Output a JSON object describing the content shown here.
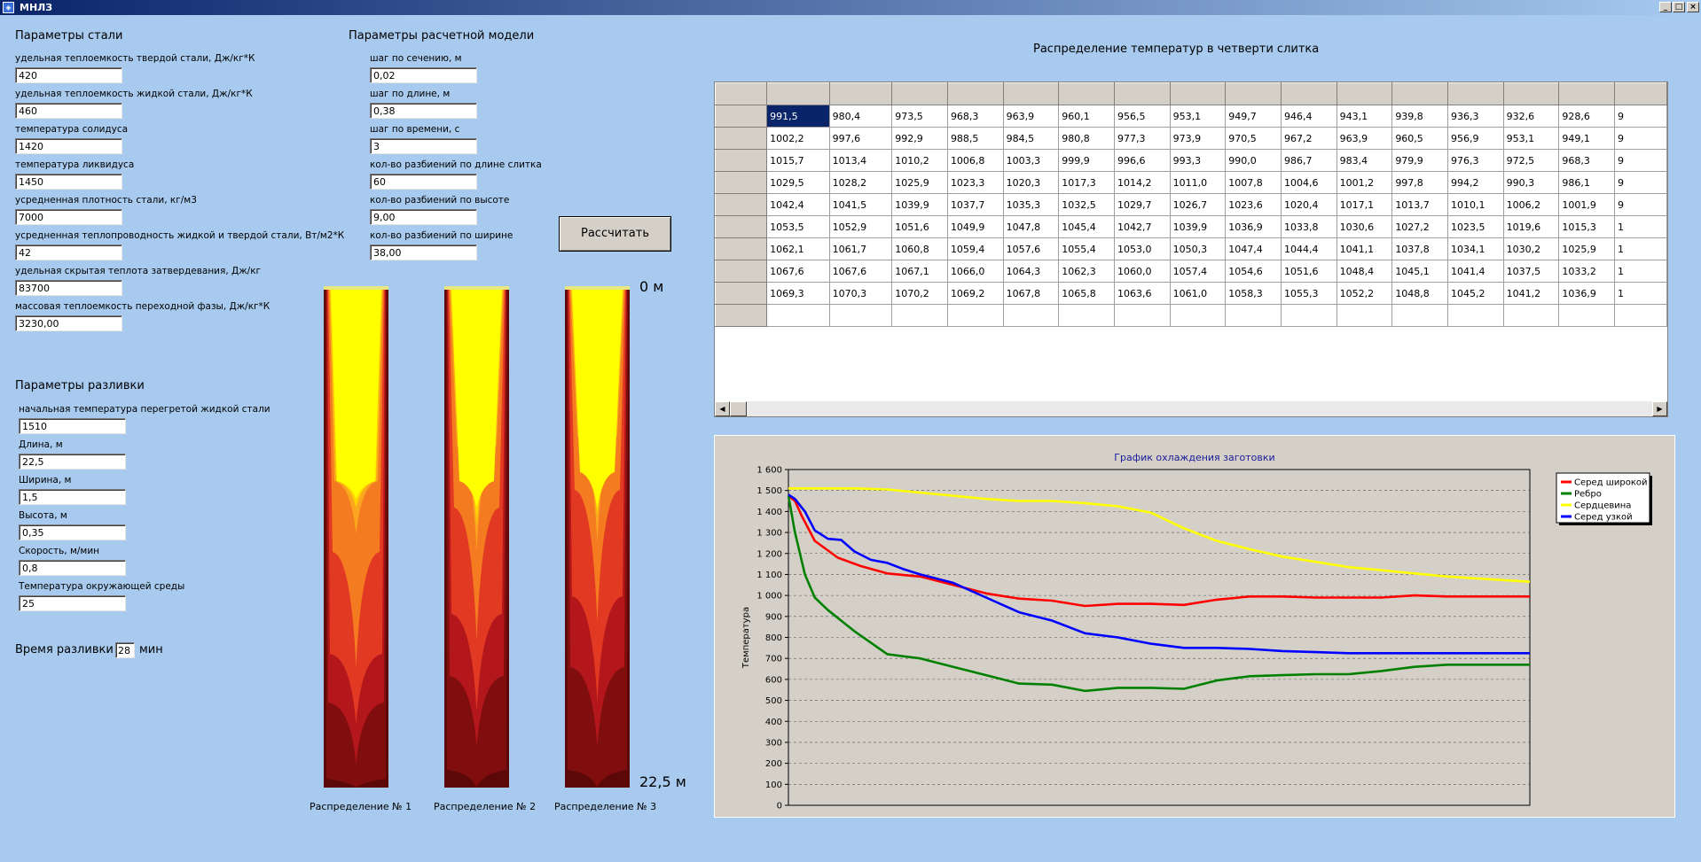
{
  "window": {
    "title": "МНЛЗ",
    "min_glyph": "_",
    "max_glyph": "□",
    "close_glyph": "×"
  },
  "steel": {
    "title": "Параметры стали",
    "fields": [
      {
        "label": "удельная теплоемкость твердой стали, Дж/кг*К",
        "value": "420"
      },
      {
        "label": "удельная теплоемкость жидкой стали, Дж/кг*К",
        "value": "460"
      },
      {
        "label": "температура солидуса",
        "value": "1420"
      },
      {
        "label": "температура ликвидуса",
        "value": "1450"
      },
      {
        "label": "усредненная плотность стали, кг/м3",
        "value": "7000"
      },
      {
        "label": "усредненная теплопроводность жидкой и твердой стали, Вт/м2*К",
        "value": "42"
      },
      {
        "label": "удельная скрытая теплота затвердевания, Дж/кг",
        "value": "83700"
      },
      {
        "label": "массовая теплоемкость переходной фазы, Дж/кг*К",
        "value": "3230,00"
      }
    ]
  },
  "model": {
    "title": "Параметры расчетной модели",
    "fields": [
      {
        "label": "шаг по сечению, м",
        "value": "0,02"
      },
      {
        "label": "шаг по длине, м",
        "value": "0,38"
      },
      {
        "label": "шаг по времени, с",
        "value": "3"
      },
      {
        "label": "кол-во разбиений по длине слитка",
        "value": "60"
      },
      {
        "label": "кол-во разбиений по высоте",
        "value": "9,00"
      },
      {
        "label": "кол-во разбиений по ширине",
        "value": "38,00"
      }
    ]
  },
  "casting": {
    "title": "Параметры разливки",
    "fields": [
      {
        "label": "начальная температура перегретой жидкой стали",
        "value": "1510"
      },
      {
        "label": "Длина, м",
        "value": "22,5"
      },
      {
        "label": "Ширина, м",
        "value": "1,5"
      },
      {
        "label": "Высота, м",
        "value": "0,35"
      },
      {
        "label": "Скорость, м/мин",
        "value": "0,8"
      },
      {
        "label": "Температура  окружающей среды",
        "value": "25"
      }
    ],
    "time_label": "Время разливки",
    "time_value": "28",
    "time_unit": "мин"
  },
  "calc_button": "Рассчитать",
  "distribution": {
    "top_mark": "0 м",
    "bottom_mark": "22,5 м",
    "labels": [
      "Распределение № 1",
      "Распределение № 2",
      "Распределение № 3"
    ],
    "colors": [
      "#ffff00",
      "#ffd500",
      "#faa61e",
      "#f47b20",
      "#e23a22",
      "#b3161b",
      "#800e0e",
      "#5c0808"
    ]
  },
  "table": {
    "title": "Распределение температур в четверти слитка",
    "rows": [
      [
        "991,5",
        "980,4",
        "973,5",
        "968,3",
        "963,9",
        "960,1",
        "956,5",
        "953,1",
        "949,7",
        "946,4",
        "943,1",
        "939,8",
        "936,3",
        "932,6",
        "928,6",
        "9"
      ],
      [
        "1002,2",
        "997,6",
        "992,9",
        "988,5",
        "984,5",
        "980,8",
        "977,3",
        "973,9",
        "970,5",
        "967,2",
        "963,9",
        "960,5",
        "956,9",
        "953,1",
        "949,1",
        "9"
      ],
      [
        "1015,7",
        "1013,4",
        "1010,2",
        "1006,8",
        "1003,3",
        "999,9",
        "996,6",
        "993,3",
        "990,0",
        "986,7",
        "983,4",
        "979,9",
        "976,3",
        "972,5",
        "968,3",
        "9"
      ],
      [
        "1029,5",
        "1028,2",
        "1025,9",
        "1023,3",
        "1020,3",
        "1017,3",
        "1014,2",
        "1011,0",
        "1007,8",
        "1004,6",
        "1001,2",
        "997,8",
        "994,2",
        "990,3",
        "986,1",
        "9"
      ],
      [
        "1042,4",
        "1041,5",
        "1039,9",
        "1037,7",
        "1035,3",
        "1032,5",
        "1029,7",
        "1026,7",
        "1023,6",
        "1020,4",
        "1017,1",
        "1013,7",
        "1010,1",
        "1006,2",
        "1001,9",
        "9"
      ],
      [
        "1053,5",
        "1052,9",
        "1051,6",
        "1049,9",
        "1047,8",
        "1045,4",
        "1042,7",
        "1039,9",
        "1036,9",
        "1033,8",
        "1030,6",
        "1027,2",
        "1023,5",
        "1019,6",
        "1015,3",
        "1"
      ],
      [
        "1062,1",
        "1061,7",
        "1060,8",
        "1059,4",
        "1057,6",
        "1055,4",
        "1053,0",
        "1050,3",
        "1047,4",
        "1044,4",
        "1041,1",
        "1037,8",
        "1034,1",
        "1030,2",
        "1025,9",
        "1"
      ],
      [
        "1067,6",
        "1067,6",
        "1067,1",
        "1066,0",
        "1064,3",
        "1062,3",
        "1060,0",
        "1057,4",
        "1054,6",
        "1051,6",
        "1048,4",
        "1045,1",
        "1041,4",
        "1037,5",
        "1033,2",
        "1"
      ],
      [
        "1069,3",
        "1070,3",
        "1070,2",
        "1069,2",
        "1067,8",
        "1065,8",
        "1063,6",
        "1061,0",
        "1058,3",
        "1055,3",
        "1052,2",
        "1048,8",
        "1045,2",
        "1041,2",
        "1036,9",
        "1"
      ]
    ],
    "scroll_left_glyph": "◀",
    "scroll_right_glyph": "▶"
  },
  "chart_data": {
    "type": "line",
    "title": "График охлаждения заготовки",
    "xlabel": "",
    "ylabel": "Температура",
    "ylim": [
      0,
      1600
    ],
    "xlim": [
      0,
      22.5
    ],
    "yticks": [
      "0",
      "100",
      "200",
      "300",
      "400",
      "500",
      "600",
      "700",
      "800",
      "900",
      "1 000",
      "1 100",
      "1 200",
      "1 300",
      "1 400",
      "1 500",
      "1 600"
    ],
    "grid": true,
    "legend_position": "top-right",
    "series": [
      {
        "name": "Серед широкой",
        "color": "#ff0000",
        "x": [
          0,
          0.2,
          0.4,
          0.8,
          1.5,
          2.2,
          3.0,
          4.0,
          5.0,
          6.0,
          7.0,
          8.0,
          9.0,
          10.0,
          11.0,
          12.0,
          13.0,
          14.0,
          15.0,
          16.0,
          17.0,
          18.0,
          19.0,
          20.0,
          21.0,
          22.5
        ],
        "y": [
          1475,
          1450,
          1380,
          1260,
          1180,
          1140,
          1105,
          1090,
          1050,
          1010,
          985,
          975,
          950,
          960,
          960,
          955,
          980,
          995,
          995,
          990,
          990,
          990,
          1000,
          995,
          995,
          995
        ]
      },
      {
        "name": "Ребро",
        "color": "#008000",
        "x": [
          0,
          0.2,
          0.5,
          0.8,
          1.2,
          2.0,
          3.0,
          4.0,
          5.0,
          6.0,
          7.0,
          8.0,
          9.0,
          10.0,
          11.0,
          12.0,
          13.0,
          14.0,
          15.0,
          16.0,
          17.0,
          18.0,
          19.0,
          20.0,
          21.0,
          22.5
        ],
        "y": [
          1475,
          1300,
          1100,
          990,
          930,
          830,
          720,
          700,
          660,
          620,
          580,
          575,
          545,
          560,
          560,
          555,
          595,
          615,
          620,
          625,
          625,
          640,
          660,
          670,
          670,
          670
        ]
      },
      {
        "name": "Сердцевина",
        "color": "#ffff00",
        "x": [
          0,
          1.0,
          2.0,
          3.0,
          4.0,
          5.0,
          6.0,
          7.0,
          8.0,
          9.0,
          10.0,
          11.0,
          12.0,
          13.0,
          14.0,
          15.0,
          16.0,
          17.0,
          18.0,
          19.0,
          20.0,
          21.0,
          22.5
        ],
        "y": [
          1510,
          1510,
          1510,
          1505,
          1490,
          1475,
          1460,
          1450,
          1450,
          1440,
          1425,
          1395,
          1320,
          1260,
          1220,
          1185,
          1160,
          1135,
          1120,
          1105,
          1090,
          1080,
          1065
        ]
      },
      {
        "name": "Серед узкой",
        "color": "#0000ff",
        "x": [
          0,
          0.2,
          0.5,
          0.8,
          1.2,
          1.6,
          2.0,
          2.5,
          3.0,
          3.5,
          4.0,
          5.0,
          6.0,
          7.0,
          8.0,
          9.0,
          10.0,
          11.0,
          12.0,
          13.0,
          14.0,
          15.0,
          16.0,
          17.0,
          18.0,
          19.0,
          20.0,
          21.0,
          22.5
        ],
        "y": [
          1480,
          1460,
          1400,
          1310,
          1270,
          1265,
          1210,
          1170,
          1155,
          1125,
          1100,
          1060,
          990,
          920,
          880,
          820,
          800,
          770,
          750,
          750,
          745,
          735,
          730,
          725,
          725,
          725,
          725,
          725,
          725
        ]
      }
    ]
  }
}
